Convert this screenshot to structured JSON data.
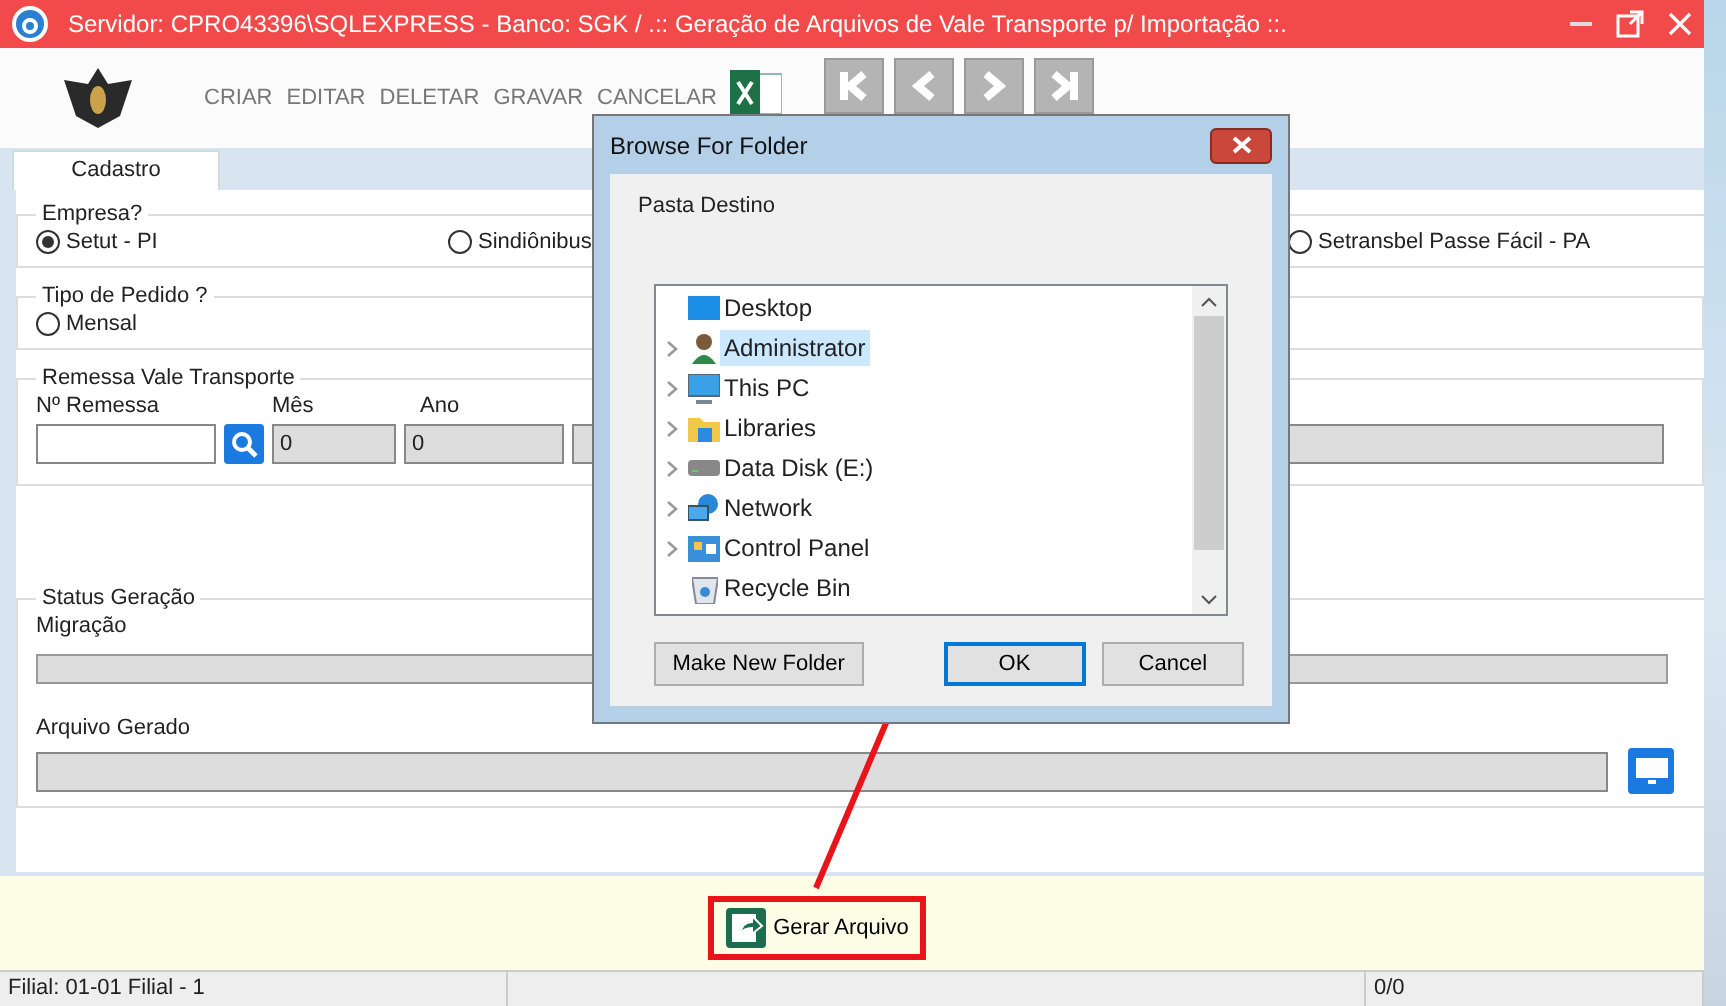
{
  "window": {
    "title": "Servidor: CPRO43396\\SQLEXPRESS - Banco: SGK / .::  Geração de Arquivos de Vale Transporte p/ Importação ::."
  },
  "toolbar": {
    "actions": [
      "CRIAR",
      "EDITAR",
      "DELETAR",
      "GRAVAR",
      "CANCELAR"
    ],
    "nav": [
      {
        "kind": "first"
      },
      {
        "kind": "prev"
      },
      {
        "kind": "next"
      },
      {
        "kind": "last"
      }
    ]
  },
  "tabs": [
    {
      "label": "Cadastro",
      "selected": true
    }
  ],
  "empresa": {
    "legend": "Empresa?",
    "options": [
      {
        "label": "Setut - PI",
        "selected": true
      },
      {
        "label": "Sindiônibus",
        "selected": false
      },
      {
        "label": "Setransbel Passe Fácil - PA",
        "selected": false
      }
    ]
  },
  "tipo_pedido": {
    "legend": "Tipo de Pedido ?",
    "options": [
      {
        "label": "Mensal",
        "selected": false
      }
    ]
  },
  "remessa": {
    "legend": "Remessa Vale Transporte",
    "number": {
      "label": "Nº Remessa"
    },
    "month": {
      "label": "Mês",
      "value": "0"
    },
    "year": {
      "label": "Ano",
      "value": "0"
    }
  },
  "status": {
    "legend": "Status Geração",
    "migration": {
      "label": "Migração",
      "level": 0
    },
    "generated_file": {
      "label": "Arquivo Gerado"
    }
  },
  "generate_button": {
    "label": "Gerar Arquivo"
  },
  "status_bar": [
    "Filial: 01-01 Filial - 1",
    "0/0"
  ],
  "dialog": {
    "title": "Browse For Folder",
    "prompt": "Pasta Destino",
    "tree": [
      {
        "label": "Desktop",
        "kind": "desktop",
        "expandable": false,
        "selected": false,
        "children": [
          {
            "label": "Administrator",
            "kind": "user",
            "expandable": true,
            "selected": true
          },
          {
            "label": "This PC",
            "kind": "pc",
            "expandable": true,
            "selected": false
          },
          {
            "label": "Libraries",
            "kind": "library",
            "expandable": true,
            "selected": false
          },
          {
            "label": "Data Disk  (E:)",
            "kind": "disk",
            "expandable": true,
            "selected": false
          },
          {
            "label": "Network",
            "kind": "network",
            "expandable": true,
            "selected": false
          },
          {
            "label": "Control Panel",
            "kind": "control",
            "expandable": true,
            "selected": false
          },
          {
            "label": "Recycle Bin",
            "kind": "bin",
            "expandable": false,
            "selected": false
          }
        ]
      }
    ],
    "buttons": [
      {
        "label": "Make New Folder",
        "default": false
      },
      {
        "label": "OK",
        "default": true
      },
      {
        "label": "Cancel",
        "default": false
      }
    ]
  }
}
